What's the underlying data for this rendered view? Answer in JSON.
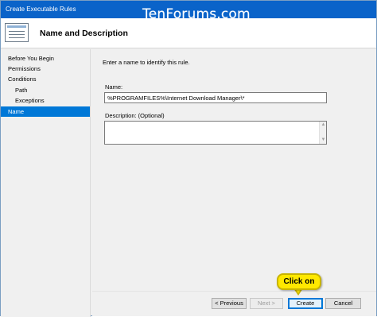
{
  "window": {
    "title": "Create Executable Rules"
  },
  "watermark": "TenForums.com",
  "header": {
    "title": "Name and Description",
    "icon": "wizard-page-icon"
  },
  "sidebar": {
    "items": [
      {
        "label": "Before You Begin"
      },
      {
        "label": "Permissions"
      },
      {
        "label": "Conditions"
      },
      {
        "label": "Path"
      },
      {
        "label": "Exceptions"
      },
      {
        "label": "Name"
      }
    ],
    "active": "Name"
  },
  "main": {
    "instruction": "Enter a name to identify this rule.",
    "name_label": "Name:",
    "name_value": "%PROGRAMFILES%\\Internet Download Manager\\*",
    "description_label": "Description: (Optional)",
    "description_value": ""
  },
  "footer": {
    "previous": "< Previous",
    "next": "Next >",
    "create": "Create",
    "cancel": "Cancel"
  },
  "callout": {
    "text": "Click on"
  },
  "colors": {
    "titlebar": "#0a63c9",
    "selected": "#0078d7",
    "callout": "#ffe800"
  }
}
